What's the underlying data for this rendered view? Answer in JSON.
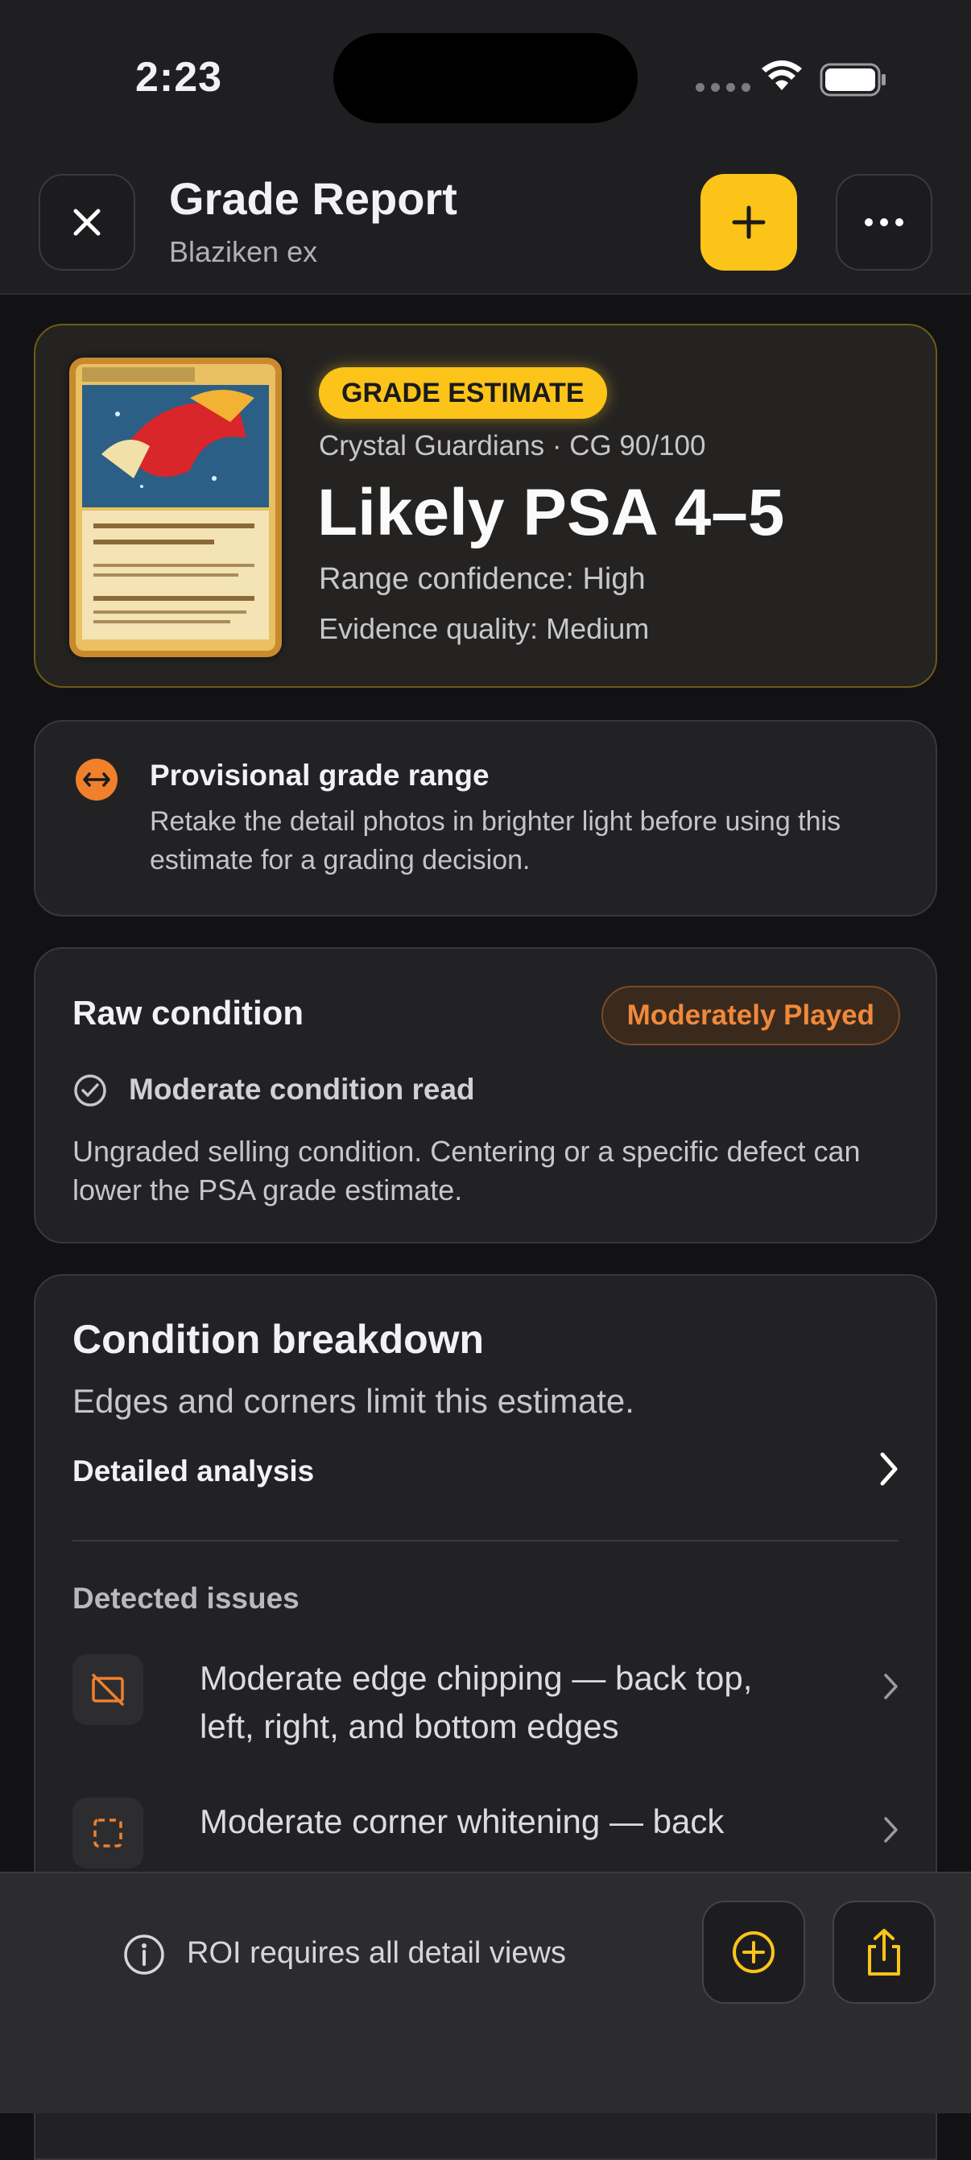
{
  "status_bar": {
    "time": "2:23"
  },
  "header": {
    "title": "Grade Report",
    "subtitle": "Blaziken ex"
  },
  "estimate": {
    "badge": "GRADE ESTIMATE",
    "set_line": "Crystal Guardians · CG 90/100",
    "grade": "Likely PSA 4–5",
    "confidence": "Range confidence: High",
    "evidence": "Evidence quality: Medium"
  },
  "notice": {
    "title": "Provisional grade range",
    "body": "Retake the detail photos in brighter light before using this estimate for a grading decision."
  },
  "raw_condition": {
    "title": "Raw condition",
    "pill": "Moderately Played",
    "check_label": "Moderate condition read",
    "body": "Ungraded selling condition. Centering or a specific defect can lower the PSA grade estimate."
  },
  "breakdown": {
    "title": "Condition breakdown",
    "subtitle": "Edges and corners limit this estimate.",
    "link": "Detailed analysis",
    "issues_heading": "Detected issues",
    "issues": [
      {
        "text": "Moderate edge chipping — back top, left, right, and bottom edges",
        "icon": "edge-icon"
      },
      {
        "text": "Moderate corner whitening — back",
        "icon": "corner-icon"
      }
    ]
  },
  "bottom_bar": {
    "roi_text": "ROI requires all detail views"
  },
  "colors": {
    "accent": "#fcc419",
    "warning": "#f0802b",
    "background": "#121214"
  }
}
